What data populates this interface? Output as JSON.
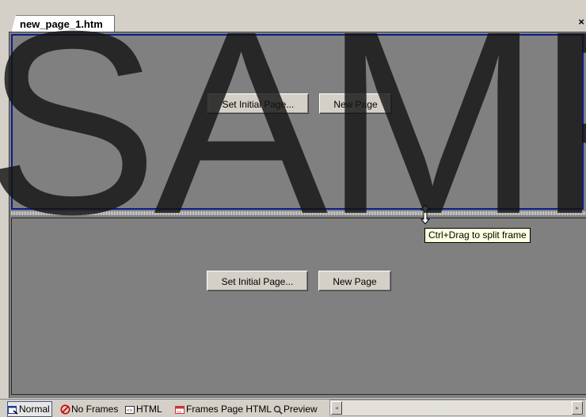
{
  "tab": {
    "title": "new_page_1.htm",
    "close": "×"
  },
  "frames": {
    "top": {
      "set_initial_label": "Set Initial Page...",
      "new_page_label": "New Page"
    },
    "bottom": {
      "set_initial_label": "Set Initial Page...",
      "new_page_label": "New Page"
    }
  },
  "tooltip": {
    "text": "Ctrl+Drag to split frame"
  },
  "watermark": {
    "text": "SAMP"
  },
  "view_tabs": {
    "normal": "Normal",
    "no_frames": "No Frames",
    "html": "HTML",
    "frames_page_html": "Frames Page HTML",
    "preview": "Preview"
  },
  "scrollbar": {
    "left_arrow": "◂",
    "right_arrow": "▸"
  },
  "colors": {
    "selected_frame_border": "#0a1e8c",
    "frame_background": "#808080",
    "tooltip_background": "#ffffe1",
    "no_frames_icon": "#cc0000",
    "frames_html_icon": "#cc3333"
  }
}
